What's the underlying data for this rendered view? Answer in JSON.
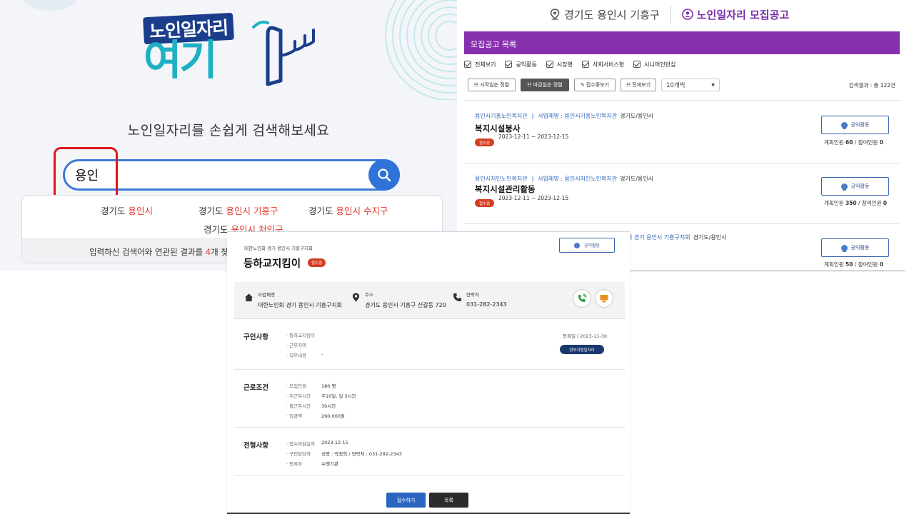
{
  "search": {
    "logo_top": "노인일자리",
    "logo_bottom": "여기",
    "tagline": "노인일자리를 손쉽게 검색해보세요",
    "query": "용인",
    "suggestions": [
      {
        "prefix": "경기도 ",
        "match": "용인시"
      },
      {
        "prefix": "경기도 ",
        "match": "용인시 기흥구"
      },
      {
        "prefix": "경기도 ",
        "match": "용인시 수지구"
      },
      {
        "prefix": "경기도 ",
        "match": "용인시 처인구"
      }
    ],
    "result_note_pre": "입력하신 검색어와 연관된 결과를 ",
    "result_note_num": "4",
    "result_note_post": "개 찾았습니다"
  },
  "list": {
    "location": "경기도 용인시 기흥구",
    "header_title": "노인일자리 모집공고",
    "panel_title": "모집공고 목록",
    "filters": [
      "전체보기",
      "공익활동",
      "시장형",
      "사회서비스형",
      "시니어인턴십"
    ],
    "sort_buttons": [
      "시작일순 정렬",
      "마감일순 정렬",
      "접수중보기",
      "전체보기"
    ],
    "page_size": "10개씩",
    "result_count": "검색결과 : 총 122건",
    "jobs": [
      {
        "org": "용인시기흥노인복지관",
        "company": "사업체명 : 용인시기흥노인복지관",
        "region": "경기도/용인시",
        "title": "복지시설봉사",
        "dates": "2023-12-11 ~ 2023-12-15",
        "status": "접수중",
        "category": "공익활동",
        "planned_label": "계획인원 ",
        "planned": "60",
        "applied_label": " / 참여인원 ",
        "applied": "0"
      },
      {
        "org": "용인시처인노인복지관",
        "company": "사업체명 : 용인시처인노인복지관",
        "region": "경기도/용인시",
        "title": "복지시설관리활동",
        "dates": "2023-12-11 ~ 2023-12-15",
        "status": "접수중",
        "category": "공익활동",
        "planned_label": "계획인원 ",
        "planned": "350",
        "applied_label": " / 참여인원 ",
        "applied": "0"
      },
      {
        "org": "",
        "company": "회 경기 용인시 기흥구지회",
        "region": "경기도/용인시",
        "title": "",
        "dates": "",
        "status": "",
        "category": "공익활동",
        "planned_label": "계획인원 ",
        "planned": "50",
        "applied_label": " / 참여인원 ",
        "applied": "0"
      }
    ]
  },
  "detail": {
    "org": "대한노인회 경기 용인시 기흥구지회",
    "title": "등하교지킴이",
    "status": "접수중",
    "category": "공익활동",
    "info": {
      "company_label": "사업체명",
      "company": "대한노인회 경기 용인시 기흥구지회",
      "address_label": "주소",
      "address": "경기도 용인시 기흥구 신갈동 720",
      "contact_label": "연락처",
      "contact": "031-282-2343"
    },
    "sections": {
      "recruit": {
        "heading": "구인사항",
        "rows": [
          [
            "· 등하교지킴이",
            ""
          ],
          [
            "· 근무지역",
            ""
          ],
          [
            "· 직무내용",
            "-"
          ]
        ],
        "reg_date": "등록일 | 2023-11-30",
        "tag": "정부지원일자리"
      },
      "conditions": {
        "heading": "근로조건",
        "rows": [
          [
            "· 모집인원",
            "180 명"
          ],
          [
            "· 주근무시간",
            "주10일, 일 3시간"
          ],
          [
            "· 월근무시간",
            "30시간"
          ],
          [
            "· 임금액",
            "290,000원"
          ]
        ]
      },
      "selection": {
        "heading": "전형사항",
        "rows": [
          [
            "· 접수마감일자",
            "2023-12-15"
          ],
          [
            "· 구인담당자",
            "성명 : 박정희 / 연락처 : 031-282-2343"
          ],
          [
            "· 등록자",
            "수행기관"
          ]
        ]
      }
    },
    "apply_label": "접수하기",
    "list_label": "목록"
  },
  "colors": {
    "accent_blue": "#2f73d8",
    "purple": "#8730ae",
    "status_red": "#d63d1f",
    "highlight_red": "#e0141e",
    "navy": "#19386e"
  }
}
